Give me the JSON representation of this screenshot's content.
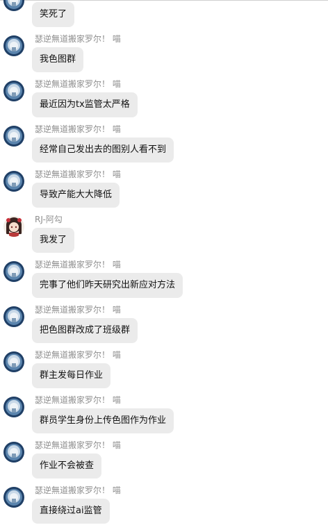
{
  "users": {
    "main_name": "瑟逆無道搬家罗尔！ 喵",
    "other_name": "RJ-阿勾"
  },
  "messages": [
    {
      "sender": "main",
      "text": "笑死了"
    },
    {
      "sender": "main",
      "text": "我色图群"
    },
    {
      "sender": "main",
      "text": "最近因为tx监管太严格"
    },
    {
      "sender": "main",
      "text": "经常自己发出去的图别人看不到"
    },
    {
      "sender": "main",
      "text": "导致产能大大降低"
    },
    {
      "sender": "other",
      "text": "我发了"
    },
    {
      "sender": "main",
      "text": "完事了他们昨天研究出新应对方法"
    },
    {
      "sender": "main",
      "text": "把色图群改成了班级群"
    },
    {
      "sender": "main",
      "text": "群主发每日作业"
    },
    {
      "sender": "main",
      "text": "群员学生身份上传色图作为作业"
    },
    {
      "sender": "main",
      "text": "作业不会被查"
    },
    {
      "sender": "main",
      "text": "直接绕过ai监管"
    }
  ]
}
